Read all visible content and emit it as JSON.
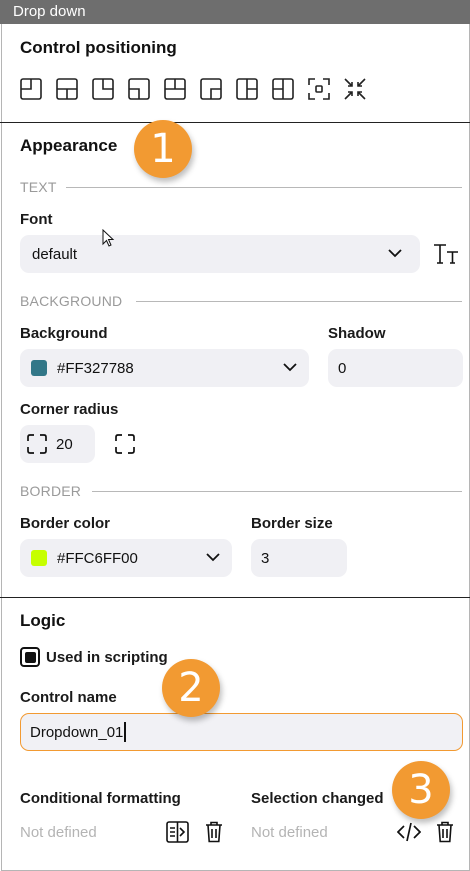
{
  "window": {
    "title": "Drop down"
  },
  "positioning": {
    "heading": "Control positioning"
  },
  "appearance": {
    "heading": "Appearance",
    "text_section": "TEXT",
    "font_label": "Font",
    "font_value": "default",
    "background_section": "BACKGROUND",
    "background_label": "Background",
    "background_value": "#FF327788",
    "background_swatch": "#327788",
    "shadow_label": "Shadow",
    "shadow_value": "0",
    "corner_label": "Corner radius",
    "corner_value": "20",
    "border_section": "BORDER",
    "border_color_label": "Border color",
    "border_color_value": "#FFC6FF00",
    "border_swatch": "#C6FF00",
    "border_size_label": "Border size",
    "border_size_value": "3"
  },
  "logic": {
    "heading": "Logic",
    "used_in_scripting_label": "Used in scripting",
    "used_in_scripting_checked": true,
    "control_name_label": "Control name",
    "control_name_value": "Dropdown_01",
    "conditional_label": "Conditional formatting",
    "conditional_value": "Not defined",
    "selection_label": "Selection changed",
    "selection_value": "Not defined"
  },
  "callouts": [
    "1",
    "2",
    "3"
  ],
  "colors": {
    "accent": "#F29A32",
    "titlebar": "#6E6E6E",
    "field_bg": "#F0F0F4"
  }
}
